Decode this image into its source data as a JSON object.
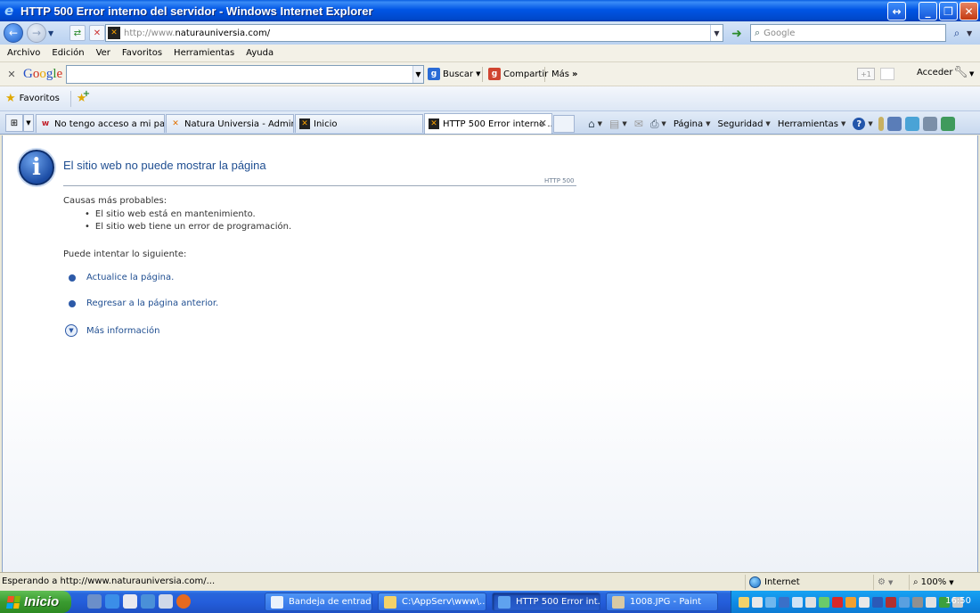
{
  "window": {
    "title": "HTTP 500 Error interno del servidor - Windows Internet Explorer"
  },
  "address": {
    "url_prefix": "http://www.",
    "url_domain": "naturauniversia.com/",
    "search_placeholder": "Google"
  },
  "menu": [
    "Archivo",
    "Edición",
    "Ver",
    "Favoritos",
    "Herramientas",
    "Ayuda"
  ],
  "google_toolbar": {
    "logo": "Google",
    "buscar": "Buscar",
    "compartir": "Compartir",
    "mas": "Más",
    "plus": "+1",
    "acceder": "Acceder"
  },
  "favorites_bar": {
    "favoritos": "Favoritos"
  },
  "tabs": [
    {
      "label": "No tengo acceso a mi pagin...",
      "icon": "webhost-icon",
      "active": false
    },
    {
      "label": "Natura Universia - Administ...",
      "icon": "joomla-icon",
      "active": false
    },
    {
      "label": "Inicio",
      "icon": "joomla-icon",
      "active": false
    },
    {
      "label": "HTTP 500 Error interno ...",
      "icon": "joomla-icon",
      "active": true
    }
  ],
  "command_bar": {
    "pagina": "Página",
    "seguridad": "Seguridad",
    "herramientas": "Herramientas"
  },
  "page": {
    "title": "El sitio web no puede mostrar la página",
    "http_code": "HTTP 500",
    "causes_label": "Causas más probables:",
    "causes": [
      "El sitio web está en mantenimiento.",
      "El sitio web tiene un error de programación."
    ],
    "try_label": "Puede intentar lo siguiente:",
    "actions": [
      "Actualice la página.",
      "Regresar a la página anterior."
    ],
    "more_info": "Más información"
  },
  "status": {
    "text": "Esperando a http://www.naturauniversia.com/...",
    "zone": "Internet",
    "zoom": "100%"
  },
  "taskbar": {
    "start": "Inicio",
    "buttons": [
      {
        "label": "Bandeja de entrad...",
        "active": false
      },
      {
        "label": "C:\\AppServ\\www\\...",
        "active": false
      },
      {
        "label": "HTTP 500 Error int...",
        "active": true
      },
      {
        "label": "1008.JPG - Paint",
        "active": false
      }
    ],
    "clock": "16:50"
  },
  "colors": {
    "titlebar": "#0055e5",
    "link": "#1f4e91",
    "taskbar": "#245edb",
    "start": "#3a9b30"
  }
}
